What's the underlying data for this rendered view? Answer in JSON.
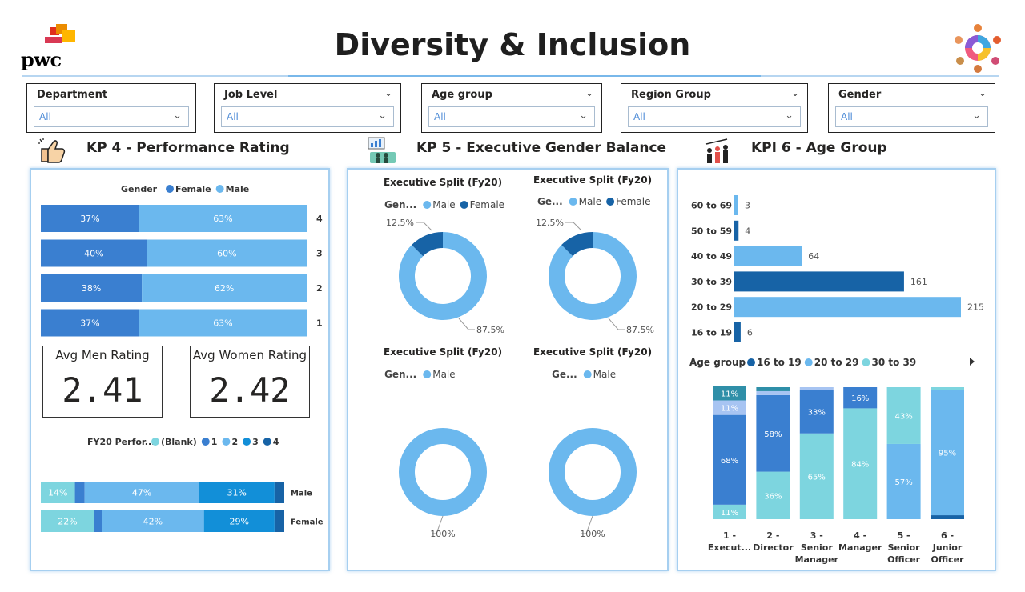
{
  "header": {
    "title": "Diversity & Inclusion",
    "logo_text": "pwc"
  },
  "filters": [
    {
      "label": "Department",
      "value": "All"
    },
    {
      "label": "Job Level",
      "value": "All"
    },
    {
      "label": "Age group",
      "value": "All"
    },
    {
      "label": "Region Group",
      "value": "All"
    },
    {
      "label": "Gender",
      "value": "All"
    }
  ],
  "kpi4": {
    "title": "KP 4 - Performance Rating",
    "avg_men_label": "Avg Men Rating",
    "avg_men_value": "2.41",
    "avg_women_label": "Avg Women Rating",
    "avg_women_value": "2.42"
  },
  "kpi5": {
    "title": "KP 5 - Executive Gender Balance"
  },
  "kpi6": {
    "title": "KPI 6 - Age Group"
  },
  "colors": {
    "dark_blue": "#1763a6",
    "mid_blue": "#3a7fd0",
    "light_blue": "#6bb8ee",
    "teal": "#7dd5df",
    "pale_blue": "#a7c4f2",
    "bright_blue": "#128fd8"
  },
  "chart_data": [
    {
      "id": "rating-by-gender",
      "type": "bar",
      "orientation": "horizontal-stacked-100",
      "legend_title": "Gender",
      "categories": [
        "4",
        "3",
        "2",
        "1"
      ],
      "series": [
        {
          "name": "Female",
          "values": [
            37,
            40,
            38,
            37
          ]
        },
        {
          "name": "Male",
          "values": [
            63,
            60,
            62,
            63
          ]
        }
      ],
      "data_labels": [
        "37%",
        "63%",
        "40%",
        "60%",
        "38%",
        "62%",
        "37%",
        "63%"
      ]
    },
    {
      "id": "fy20-performance-by-gender",
      "type": "bar",
      "orientation": "horizontal-stacked-100",
      "legend_title": "FY20 Perfor...",
      "categories": [
        "Male",
        "Female"
      ],
      "series": [
        {
          "name": "(Blank)",
          "values": [
            14,
            22
          ]
        },
        {
          "name": "1",
          "values": [
            4,
            3
          ]
        },
        {
          "name": "2",
          "values": [
            47,
            42
          ]
        },
        {
          "name": "3",
          "values": [
            31,
            29
          ]
        },
        {
          "name": "4",
          "values": [
            4,
            4
          ]
        }
      ],
      "data_labels": [
        "14%",
        "47%",
        "31%",
        "22%",
        "42%",
        "29%"
      ]
    },
    {
      "id": "exec-split-1",
      "type": "pie",
      "variant": "donut",
      "title": "Executive Split (Fy20)",
      "legend_title": "Gen...",
      "slices": [
        {
          "name": "Male",
          "value": 87.5
        },
        {
          "name": "Female",
          "value": 12.5
        }
      ],
      "slice_labels": [
        "87.5%",
        "12.5%"
      ]
    },
    {
      "id": "exec-split-2",
      "type": "pie",
      "variant": "donut",
      "title": "Executive Split (Fy20)",
      "legend_title": "Ge...",
      "slices": [
        {
          "name": "Male",
          "value": 87.5
        },
        {
          "name": "Female",
          "value": 12.5
        }
      ],
      "slice_labels": [
        "87.5%",
        "12.5%"
      ]
    },
    {
      "id": "exec-split-3",
      "type": "pie",
      "variant": "donut",
      "title": "Executive Split (Fy20)",
      "legend_title": "Gen...",
      "slices": [
        {
          "name": "Male",
          "value": 100
        }
      ],
      "slice_labels": [
        "100%"
      ]
    },
    {
      "id": "exec-split-4",
      "type": "pie",
      "variant": "donut",
      "title": "Executive Split (Fy20)",
      "legend_title": "Ge...",
      "slices": [
        {
          "name": "Male",
          "value": 100
        }
      ],
      "slice_labels": [
        "100%"
      ]
    },
    {
      "id": "age-group-counts",
      "type": "bar",
      "orientation": "horizontal",
      "categories": [
        "60 to 69",
        "50 to 59",
        "40 to 49",
        "30 to 39",
        "20 to 29",
        "16 to 19"
      ],
      "values": [
        3,
        4,
        64,
        161,
        215,
        6
      ],
      "xlim": [
        0,
        215
      ]
    },
    {
      "id": "age-group-by-job-level",
      "type": "bar",
      "orientation": "vertical-stacked-100",
      "legend_title": "Age group",
      "legend_visible": [
        "16 to 19",
        "20 to 29",
        "30 to 39"
      ],
      "categories": [
        "1 - Execut...",
        "2 - Director",
        "3 - Senior Manager",
        "4 - Manager",
        "5 - Senior Officer",
        "6 - Junior Officer"
      ],
      "segments_bottom_to_top": [
        [
          {
            "color": "teal",
            "value": 11,
            "label": "11%"
          },
          {
            "color": "mid_blue",
            "value": 68,
            "label": "68%"
          },
          {
            "color": "pale_blue",
            "value": 11,
            "label": "11%"
          },
          {
            "color": "deep_teal",
            "value": 11,
            "label": "11%"
          }
        ],
        [
          {
            "color": "teal",
            "value": 36,
            "label": "36%"
          },
          {
            "color": "mid_blue",
            "value": 58,
            "label": "58%"
          },
          {
            "color": "pale_blue",
            "value": 3,
            "label": ""
          },
          {
            "color": "deep_teal",
            "value": 3,
            "label": ""
          }
        ],
        [
          {
            "color": "teal",
            "value": 65,
            "label": "65%"
          },
          {
            "color": "mid_blue",
            "value": 33,
            "label": "33%"
          },
          {
            "color": "pale_blue",
            "value": 2,
            "label": ""
          }
        ],
        [
          {
            "color": "teal",
            "value": 84,
            "label": "84%"
          },
          {
            "color": "mid_blue",
            "value": 16,
            "label": "16%"
          }
        ],
        [
          {
            "color": "light_blue",
            "value": 57,
            "label": "57%"
          },
          {
            "color": "teal",
            "value": 43,
            "label": "43%"
          }
        ],
        [
          {
            "color": "dark_blue",
            "value": 3,
            "label": ""
          },
          {
            "color": "light_blue",
            "value": 95,
            "label": "95%"
          },
          {
            "color": "teal",
            "value": 2,
            "label": ""
          }
        ]
      ]
    }
  ]
}
